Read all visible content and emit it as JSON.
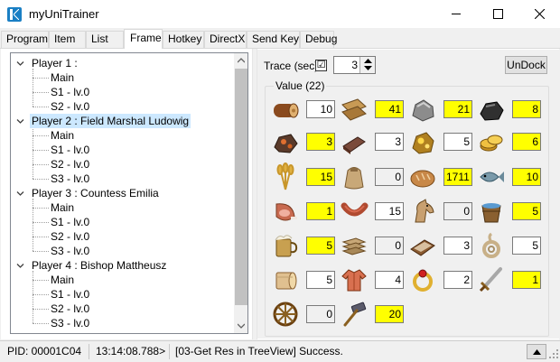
{
  "window": {
    "title": "myUniTrainer"
  },
  "tabs": [
    {
      "label": "Program"
    },
    {
      "label": "Item"
    },
    {
      "label": "List"
    },
    {
      "label": "Frame",
      "active": true
    },
    {
      "label": "Hotkey"
    },
    {
      "label": "DirectX"
    },
    {
      "label": "Send Key"
    },
    {
      "label": "Debug"
    }
  ],
  "tree": {
    "nodes": [
      {
        "label": "Player 1 :",
        "level": 0,
        "expanded": true
      },
      {
        "label": "Main",
        "level": 1
      },
      {
        "label": "S1 - lv.0",
        "level": 1
      },
      {
        "label": "S2 - lv.0",
        "level": 1
      },
      {
        "label": "Player 2 : Field Marshal Ludowig",
        "level": 0,
        "expanded": true,
        "selected": true
      },
      {
        "label": "Main",
        "level": 1
      },
      {
        "label": "S1 - lv.0",
        "level": 1
      },
      {
        "label": "S2 - lv.0",
        "level": 1
      },
      {
        "label": "S3 - lv.0",
        "level": 1
      },
      {
        "label": "Player 3 : Countess Emilia",
        "level": 0,
        "expanded": true
      },
      {
        "label": "Main",
        "level": 1
      },
      {
        "label": "S1 - lv.0",
        "level": 1
      },
      {
        "label": "S2 - lv.0",
        "level": 1
      },
      {
        "label": "S3 - lv.0",
        "level": 1
      },
      {
        "label": "Player 4 : Bishop Mattheusz",
        "level": 0,
        "expanded": true
      },
      {
        "label": "Main",
        "level": 1
      },
      {
        "label": "S1 - lv.0",
        "level": 1
      },
      {
        "label": "S2 - lv.0",
        "level": 1
      },
      {
        "label": "S3 - lv.0",
        "level": 1
      }
    ]
  },
  "trace": {
    "label": "Trace (sec)",
    "checked": true,
    "check_glyph": "☑",
    "value": "3",
    "spin_glyph": "▲▼"
  },
  "undock": {
    "label": "UnDock"
  },
  "values": {
    "label": "Value (22)",
    "items": [
      {
        "icon": "log-icon",
        "value": "10",
        "highlight": "none"
      },
      {
        "icon": "planks-icon",
        "value": "41",
        "highlight": "yellow"
      },
      {
        "icon": "stone-icon",
        "value": "21",
        "highlight": "yellow"
      },
      {
        "icon": "coal-icon",
        "value": "8",
        "highlight": "yellow"
      },
      {
        "icon": "iron-ore-icon",
        "value": "3",
        "highlight": "yellow"
      },
      {
        "icon": "iron-ingot-icon",
        "value": "3",
        "highlight": "none"
      },
      {
        "icon": "gold-ore-icon",
        "value": "5",
        "highlight": "none"
      },
      {
        "icon": "gold-coins-icon",
        "value": "6",
        "highlight": "yellow"
      },
      {
        "icon": "wheat-icon",
        "value": "15",
        "highlight": "yellow"
      },
      {
        "icon": "flour-icon",
        "value": "0",
        "highlight": "gray"
      },
      {
        "icon": "bread-icon",
        "value": "1711",
        "highlight": "yellow"
      },
      {
        "icon": "fish-icon",
        "value": "10",
        "highlight": "yellow"
      },
      {
        "icon": "ham-icon",
        "value": "1",
        "highlight": "yellow"
      },
      {
        "icon": "sausage-icon",
        "value": "15",
        "highlight": "none"
      },
      {
        "icon": "horse-icon",
        "value": "0",
        "highlight": "gray"
      },
      {
        "icon": "water-bucket-icon",
        "value": "5",
        "highlight": "yellow"
      },
      {
        "icon": "beer-icon",
        "value": "5",
        "highlight": "yellow"
      },
      {
        "icon": "hides-icon",
        "value": "0",
        "highlight": "gray"
      },
      {
        "icon": "leather-icon",
        "value": "3",
        "highlight": "none"
      },
      {
        "icon": "rope-icon",
        "value": "5",
        "highlight": "none"
      },
      {
        "icon": "cloth-roll-icon",
        "value": "5",
        "highlight": "none"
      },
      {
        "icon": "tunic-icon",
        "value": "4",
        "highlight": "none"
      },
      {
        "icon": "ring-icon",
        "value": "2",
        "highlight": "none"
      },
      {
        "icon": "sword-icon",
        "value": "1",
        "highlight": "yellow"
      },
      {
        "icon": "wheel-icon",
        "value": "0",
        "highlight": "gray"
      },
      {
        "icon": "hammer-icon",
        "value": "20",
        "highlight": "yellow"
      }
    ]
  },
  "status": {
    "pid": "PID: 00001C04",
    "time": "13:14:08.788>",
    "message": "[03-Get Res in TreeView] Success."
  },
  "colors": {
    "highlight": "#ffff00",
    "selection": "#cce8ff",
    "accent": "#1a7fc4"
  }
}
